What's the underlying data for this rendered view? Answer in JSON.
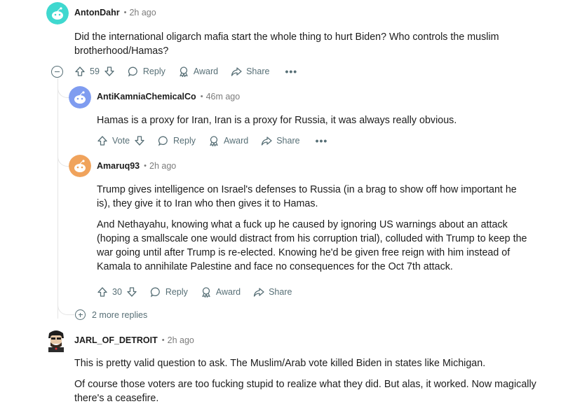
{
  "comments": [
    {
      "author": "AntonDahr",
      "dot": "•",
      "time": "2h ago",
      "paragraphs": [
        "Did the international oligarch mafia start the whole thing to hurt Biden? Who controls the muslim brotherhood/Hamas?"
      ],
      "votes": "59",
      "reply_label": "Reply",
      "award_label": "Award",
      "share_label": "Share",
      "more_label": "•••"
    },
    {
      "author": "AntiKamniaChemicalCo",
      "dot": "•",
      "time": "46m ago",
      "paragraphs": [
        "Hamas is a proxy for Iran, Iran is a proxy for Russia, it was always really obvious."
      ],
      "votes": "Vote",
      "reply_label": "Reply",
      "award_label": "Award",
      "share_label": "Share",
      "more_label": "•••"
    },
    {
      "author": "Amaruq93",
      "dot": "•",
      "time": "2h ago",
      "paragraphs": [
        "Trump gives intelligence on Israel's defenses to Russia (in a brag to show off how important he is), they give it to Iran who then gives it to Hamas.",
        "And Nethayahu, knowing what a fuck up he caused by ignoring US warnings about an attack (hoping a smallscale one would distract from his corruption trial), colluded with Trump to keep the war going until after Trump is re-elected. Knowing he'd be given free reign with him instead of Kamala to annihilate Palestine and face no consequences for the Oct 7th attack."
      ],
      "votes": "30",
      "reply_label": "Reply",
      "award_label": "Award",
      "share_label": "Share"
    },
    {
      "author": "JARL_OF_DETROIT",
      "dot": "•",
      "time": "2h ago",
      "paragraphs": [
        "This is pretty valid question to ask. The Muslim/Arab vote killed Biden in states like Michigan.",
        "Of course those voters are too fucking stupid to realize what they did. But alas, it worked. Now magically there's a ceasefire."
      ]
    }
  ],
  "more_replies": "2 more replies",
  "colors": {
    "text": "#1c1c1c",
    "meta": "#7c7c7c",
    "action": "#576f76",
    "thread": "#e5e5e5",
    "avatar_teal": "#3fd8cf",
    "avatar_blue": "#7f9cf0",
    "avatar_orange": "#f0a35c"
  },
  "icons": [
    "upvote-icon",
    "downvote-icon",
    "reply-icon",
    "award-icon",
    "share-icon",
    "collapse-icon",
    "expand-icon",
    "more-icon"
  ]
}
